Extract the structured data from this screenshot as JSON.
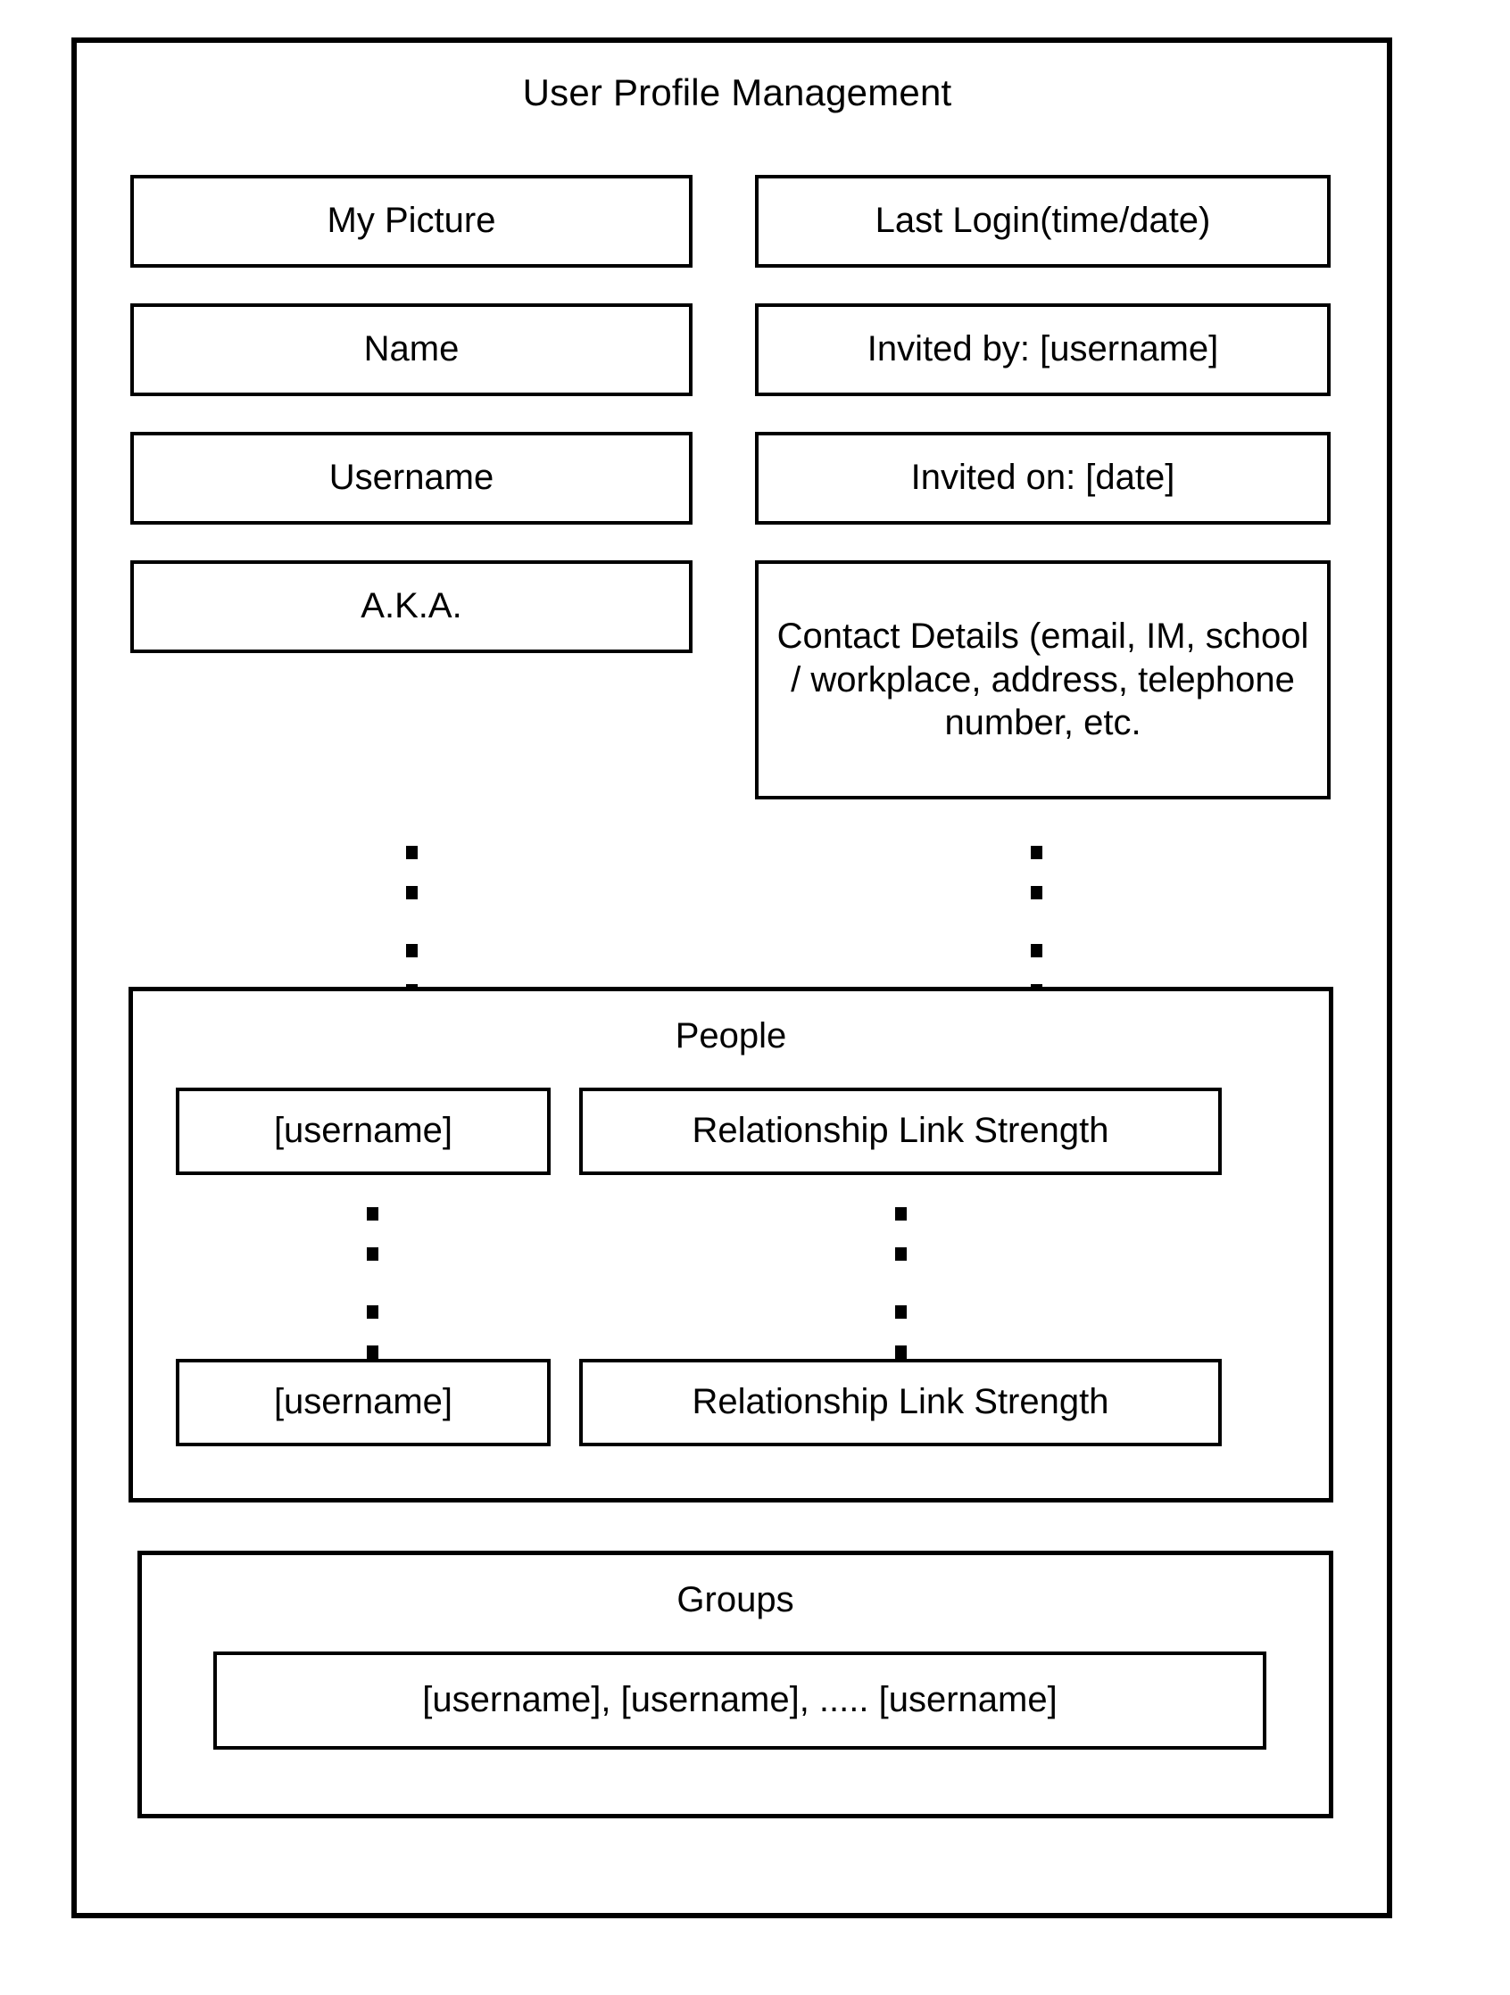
{
  "diagram": {
    "title": "User Profile Management",
    "left_column": [
      {
        "label": "My Picture"
      },
      {
        "label": "Name"
      },
      {
        "label": "Username"
      },
      {
        "label": "A.K.A."
      }
    ],
    "right_column": [
      {
        "label": "Last Login(time/date)"
      },
      {
        "label": "Invited by: [username]"
      },
      {
        "label": "Invited on: [date]"
      },
      {
        "label": "Contact Details (email, IM, school / workplace, address, telephone number, etc."
      }
    ],
    "ellipsis_marker": "vertical-ellipsis",
    "people": {
      "title": "People",
      "rows": [
        {
          "username": "[username]",
          "relationship": "Relationship Link Strength"
        },
        {
          "username": "[username]",
          "relationship": "Relationship Link Strength"
        }
      ]
    },
    "groups": {
      "title": "Groups",
      "members": "[username], [username], .....  [username]"
    }
  }
}
